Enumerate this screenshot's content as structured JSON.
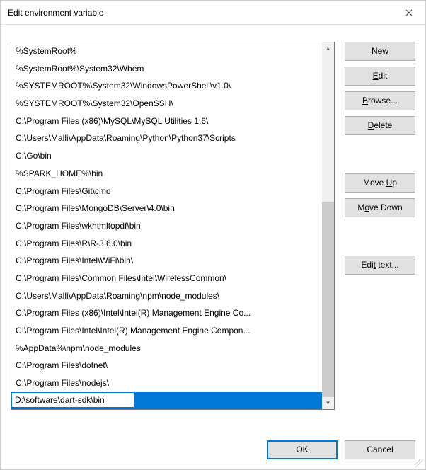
{
  "title": "Edit environment variable",
  "paths": [
    "%SystemRoot%",
    "%SystemRoot%\\System32\\Wbem",
    "%SYSTEMROOT%\\System32\\WindowsPowerShell\\v1.0\\",
    "%SYSTEMROOT%\\System32\\OpenSSH\\",
    "C:\\Program Files (x86)\\MySQL\\MySQL Utilities 1.6\\",
    "C:\\Users\\Malli\\AppData\\Roaming\\Python\\Python37\\Scripts",
    "C:\\Go\\bin",
    "%SPARK_HOME%\\bin",
    "C:\\Program Files\\Git\\cmd",
    "C:\\Program Files\\MongoDB\\Server\\4.0\\bin",
    "C:\\Program Files\\wkhtmltopdf\\bin",
    "C:\\Program Files\\R\\R-3.6.0\\bin",
    "C:\\Program Files\\Intel\\WiFi\\bin\\",
    "C:\\Program Files\\Common Files\\Intel\\WirelessCommon\\",
    "C:\\Users\\Malli\\AppData\\Roaming\\npm\\node_modules\\",
    "C:\\Program Files (x86)\\Intel\\Intel(R) Management Engine Co...",
    "C:\\Program Files\\Intel\\Intel(R) Management Engine Compon...",
    "%AppData%\\npm\\node_modules",
    "C:\\Program Files\\dotnet\\",
    "C:\\Program Files\\nodejs\\"
  ],
  "editing_value": "D:\\software\\dart-sdk\\bin",
  "buttons": {
    "new": "New",
    "edit": "Edit",
    "browse": "Browse...",
    "delete": "Delete",
    "moveup": "Move Up",
    "movedown": "Move Down",
    "edittext": "Edit text...",
    "ok": "OK",
    "cancel": "Cancel"
  },
  "accel": {
    "new": "N",
    "edit": "E",
    "browse": "B",
    "delete": "D",
    "moveup": "U",
    "movedown": "o",
    "edittext": "t"
  }
}
